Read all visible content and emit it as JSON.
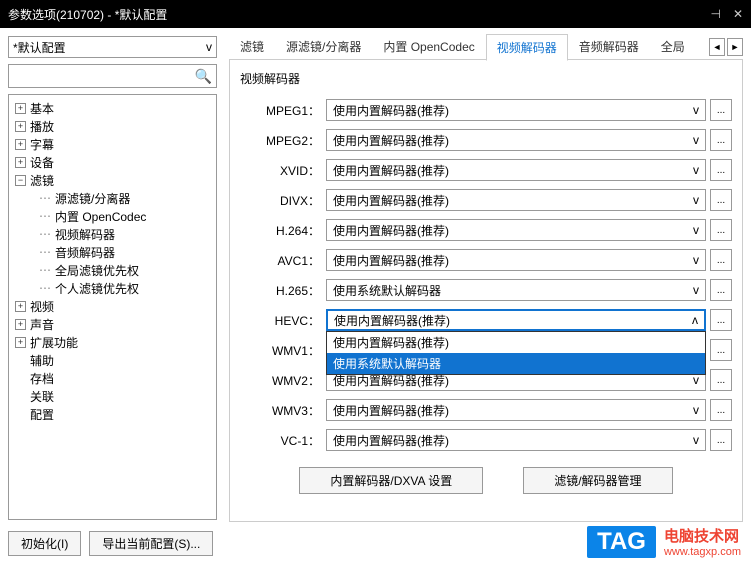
{
  "window": {
    "title": "参数选项(210702) - *默认配置"
  },
  "preset": {
    "selected": "*默认配置",
    "caret": "v"
  },
  "search": {
    "placeholder": ""
  },
  "tree": {
    "items": [
      {
        "label": "基本",
        "expand": "+"
      },
      {
        "label": "播放",
        "expand": "+"
      },
      {
        "label": "字幕",
        "expand": "+"
      },
      {
        "label": "设备",
        "expand": "+"
      },
      {
        "label": "滤镜",
        "expand": "−",
        "children": [
          {
            "label": "源滤镜/分离器"
          },
          {
            "label": "内置 OpenCodec"
          },
          {
            "label": "视频解码器"
          },
          {
            "label": "音频解码器"
          },
          {
            "label": "全局滤镜优先权"
          },
          {
            "label": "个人滤镜优先权"
          }
        ]
      },
      {
        "label": "视频",
        "expand": "+"
      },
      {
        "label": "声音",
        "expand": "+"
      },
      {
        "label": "扩展功能",
        "expand": "+"
      },
      {
        "label": "辅助",
        "expand": ""
      },
      {
        "label": "存档",
        "expand": ""
      },
      {
        "label": "关联",
        "expand": ""
      },
      {
        "label": "配置",
        "expand": ""
      }
    ]
  },
  "tabs": {
    "items": [
      "滤镜",
      "源滤镜/分离器",
      "内置 OpenCodec",
      "视频解码器",
      "音频解码器",
      "全局"
    ],
    "active_index": 3
  },
  "panel": {
    "title": "视频解码器",
    "recommended": "使用内置解码器(推荐)",
    "system_default": "使用系统默认解码器",
    "rows": [
      {
        "label": "MPEG1：",
        "value": "使用内置解码器(推荐)"
      },
      {
        "label": "MPEG2：",
        "value": "使用内置解码器(推荐)"
      },
      {
        "label": "XVID：",
        "value": "使用内置解码器(推荐)"
      },
      {
        "label": "DIVX：",
        "value": "使用内置解码器(推荐)"
      },
      {
        "label": "H.264：",
        "value": "使用内置解码器(推荐)"
      },
      {
        "label": "AVC1：",
        "value": "使用内置解码器(推荐)"
      },
      {
        "label": "H.265：",
        "value": "使用系统默认解码器"
      },
      {
        "label": "HEVC：",
        "value": "使用内置解码器(推荐)",
        "open": true
      },
      {
        "label": "WMV1：",
        "value": ""
      },
      {
        "label": "WMV2：",
        "value": "使用内置解码器(推荐)"
      },
      {
        "label": "WMV3：",
        "value": "使用内置解码器(推荐)"
      },
      {
        "label": "VC-1：",
        "value": "使用内置解码器(推荐)"
      }
    ],
    "dropdown_options": [
      "使用内置解码器(推荐)",
      "使用系统默认解码器"
    ],
    "buttons": {
      "dxva": "内置解码器/DXVA 设置",
      "manage": "滤镜/解码器管理"
    }
  },
  "footer": {
    "init": "初始化(I)",
    "export": "导出当前配置(S)..."
  },
  "watermark": {
    "tag": "TAG",
    "text": "电脑技术网",
    "url": "www.tagxp.com"
  }
}
